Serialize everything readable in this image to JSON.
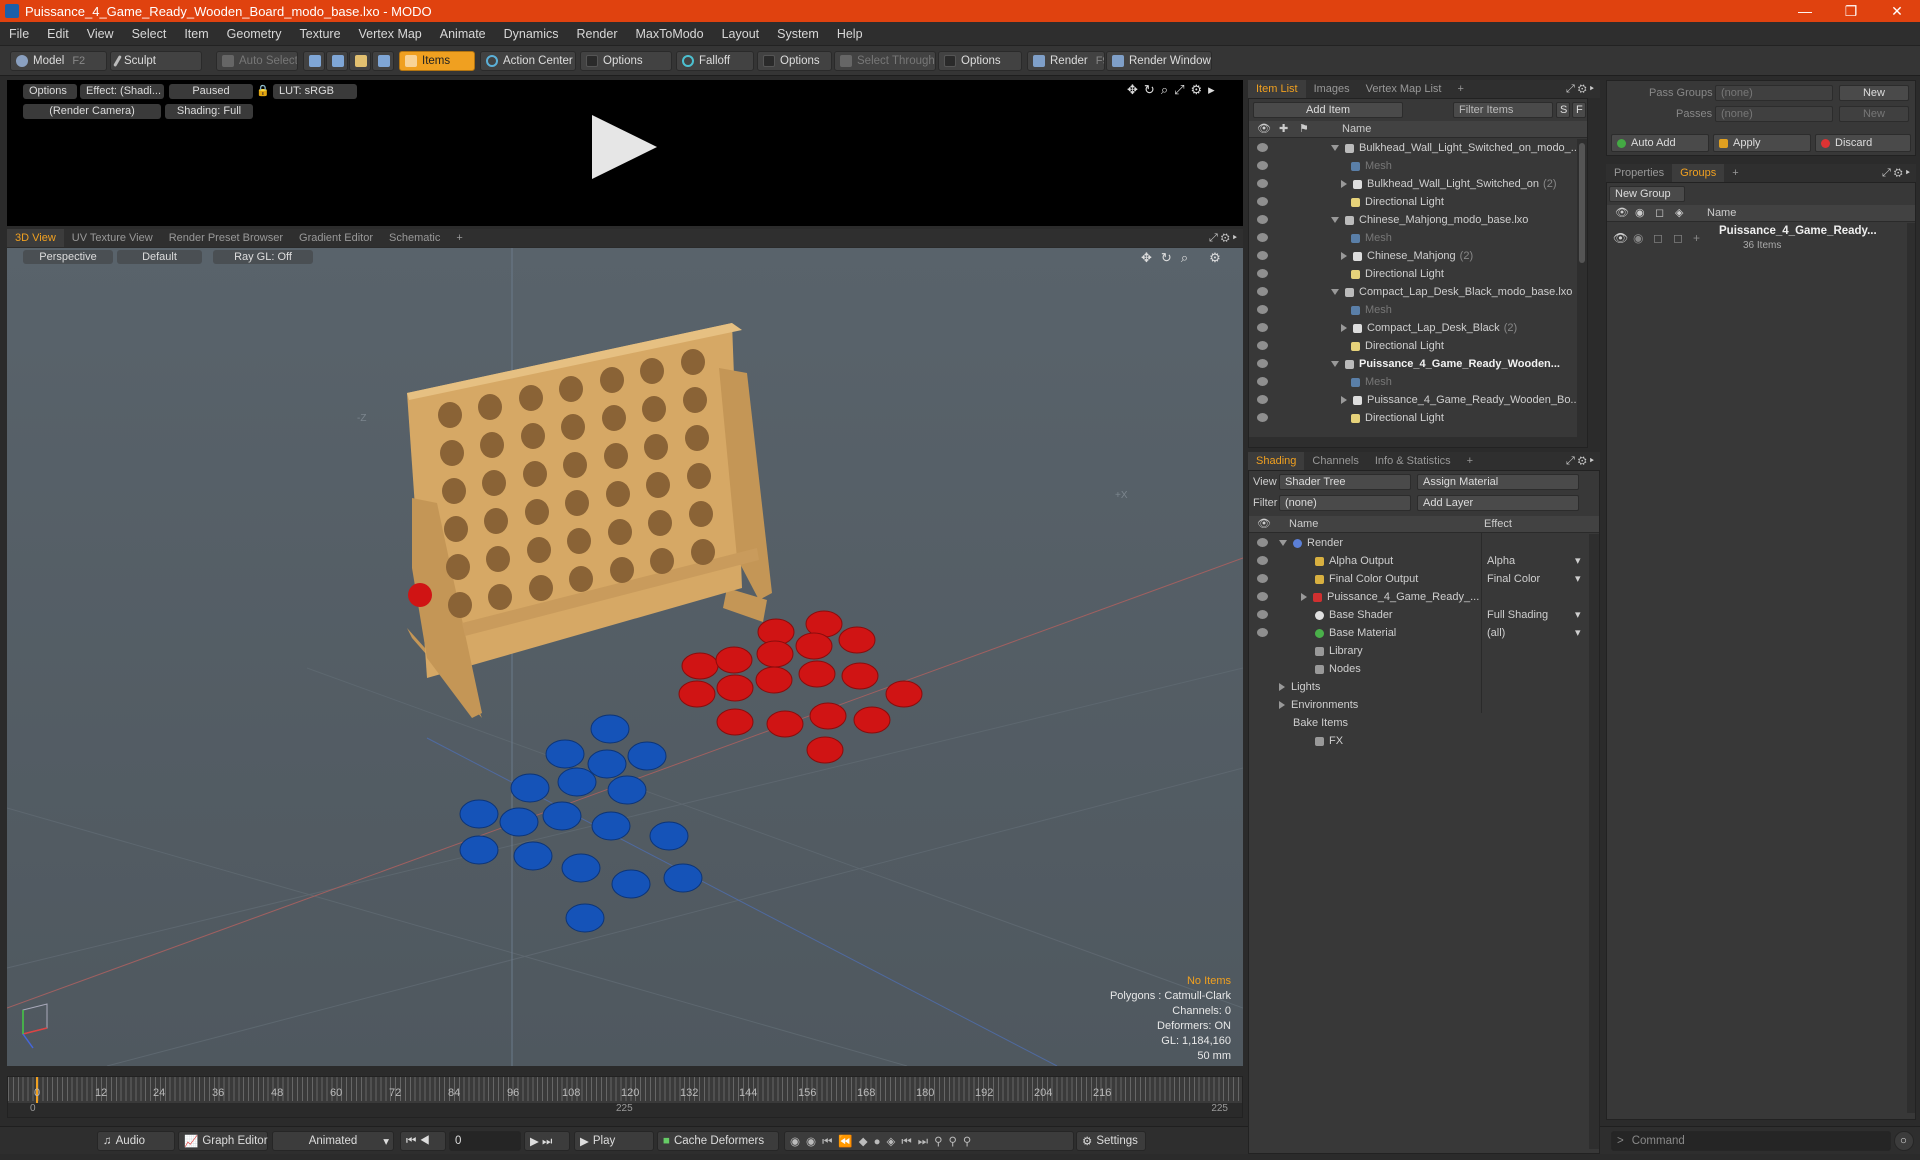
{
  "title": "Puissance_4_Game_Ready_Wooden_Board_modo_base.lxo - MODO",
  "window_controls": [
    "—",
    "❐",
    "✕"
  ],
  "menu": [
    "File",
    "Edit",
    "View",
    "Select",
    "Item",
    "Geometry",
    "Texture",
    "Vertex Map",
    "Animate",
    "Dynamics",
    "Render",
    "MaxToModo",
    "Layout",
    "System",
    "Help"
  ],
  "toolbar": {
    "model": "Model",
    "model_key": "F2",
    "sculpt": "Sculpt",
    "auto_select": "Auto Select",
    "items": "Items",
    "action_center": "Action Center",
    "options1": "Options",
    "falloff": "Falloff",
    "options2": "Options",
    "select_through": "Select Through",
    "options3": "Options",
    "render": "Render",
    "render_key": "F9",
    "render_window": "Render Window"
  },
  "preview": {
    "options": "Options",
    "effect": "Effect: (Shadi...",
    "paused": "Paused",
    "lut": "LUT: sRGB",
    "camera": "(Render Camera)",
    "shading": "Shading: Full"
  },
  "view_tabs": [
    "3D View",
    "UV Texture View",
    "Render Preset Browser",
    "Gradient Editor",
    "Schematic",
    "+"
  ],
  "viewport": {
    "perspective": "Perspective",
    "default": "Default",
    "raygl": "Ray GL: Off",
    "axis_z": "-Z",
    "axis_x": "+X",
    "no_items": "No Items",
    "polygons": "Polygons : Catmull-Clark",
    "channels": "Channels: 0",
    "deformers": "Deformers: ON",
    "gl": "GL: 1,184,160",
    "focal": "50 mm"
  },
  "timeline": {
    "ticks": [
      "0",
      "12",
      "24",
      "36",
      "48",
      "60",
      "72",
      "84",
      "96",
      "108",
      "120",
      "132",
      "144",
      "156",
      "168",
      "180",
      "192",
      "204",
      "216"
    ],
    "start": "0",
    "mid": "225",
    "end": "225"
  },
  "bottom": {
    "audio": "Audio",
    "graph_editor": "Graph Editor",
    "animated": "Animated",
    "frame": "0",
    "play": "Play",
    "cache": "Cache Deformers",
    "settings": "Settings",
    "command": "Command"
  },
  "item_list": {
    "tabs": [
      "Item List",
      "Images",
      "Vertex Map List",
      "+"
    ],
    "add_item": "Add Item",
    "filter": "Filter Items",
    "s": "S",
    "f": "F",
    "col_name": "Name",
    "rows": [
      {
        "text": "Bulkhead_Wall_Light_Switched_on_modo_...",
        "indent": 0,
        "kind": "scene",
        "style": ""
      },
      {
        "text": "Mesh",
        "indent": 2,
        "kind": "mesh",
        "style": "dim"
      },
      {
        "text": "Bulkhead_Wall_Light_Switched_on",
        "sub": "(2)",
        "indent": 1,
        "kind": "group",
        "style": ""
      },
      {
        "text": "Directional Light",
        "indent": 2,
        "kind": "light",
        "style": ""
      },
      {
        "text": "Chinese_Mahjong_modo_base.lxo",
        "indent": 0,
        "kind": "scene",
        "style": ""
      },
      {
        "text": "Mesh",
        "indent": 2,
        "kind": "mesh",
        "style": "dim"
      },
      {
        "text": "Chinese_Mahjong",
        "sub": "(2)",
        "indent": 1,
        "kind": "group",
        "style": ""
      },
      {
        "text": "Directional Light",
        "indent": 2,
        "kind": "light",
        "style": ""
      },
      {
        "text": "Compact_Lap_Desk_Black_modo_base.lxo",
        "indent": 0,
        "kind": "scene",
        "style": ""
      },
      {
        "text": "Mesh",
        "indent": 2,
        "kind": "mesh",
        "style": "dim"
      },
      {
        "text": "Compact_Lap_Desk_Black",
        "sub": "(2)",
        "indent": 1,
        "kind": "group",
        "style": ""
      },
      {
        "text": "Directional Light",
        "indent": 2,
        "kind": "light",
        "style": ""
      },
      {
        "text": "Puissance_4_Game_Ready_Wooden...",
        "indent": 0,
        "kind": "scene",
        "style": "bold"
      },
      {
        "text": "Mesh",
        "indent": 2,
        "kind": "mesh",
        "style": "dim"
      },
      {
        "text": "Puissance_4_Game_Ready_Wooden_Bo...",
        "indent": 1,
        "kind": "group",
        "style": ""
      },
      {
        "text": "Directional Light",
        "indent": 2,
        "kind": "light",
        "style": ""
      }
    ]
  },
  "shading": {
    "tabs": [
      "Shading",
      "Channels",
      "Info & Statistics",
      "+"
    ],
    "view_label": "View",
    "view_value": "Shader Tree",
    "assign": "Assign Material",
    "filter_label": "Filter",
    "filter_value": "(none)",
    "add_layer": "Add Layer",
    "col_name": "Name",
    "col_effect": "Effect",
    "rows": [
      {
        "name": "Render",
        "effect": "",
        "indent": 0
      },
      {
        "name": "Alpha Output",
        "effect": "Alpha",
        "indent": 1
      },
      {
        "name": "Final Color Output",
        "effect": "Final Color",
        "indent": 1
      },
      {
        "name": "Puissance_4_Game_Ready_...",
        "effect": "",
        "indent": 1
      },
      {
        "name": "Base Shader",
        "effect": "Full Shading",
        "indent": 1
      },
      {
        "name": "Base Material",
        "effect": "(all)",
        "indent": 1
      },
      {
        "name": "Library",
        "effect": "",
        "indent": 1
      },
      {
        "name": "Nodes",
        "effect": "",
        "indent": 1
      },
      {
        "name": "Lights",
        "effect": "",
        "indent": 0
      },
      {
        "name": "Environments",
        "effect": "",
        "indent": 0
      },
      {
        "name": "Bake Items",
        "effect": "",
        "indent": 0
      },
      {
        "name": "FX",
        "effect": "",
        "indent": 1
      }
    ]
  },
  "right": {
    "pass_groups_label": "Pass Groups",
    "pass_groups_value": "(none)",
    "new": "New",
    "passes_label": "Passes",
    "passes_value": "(none)",
    "new2": "New",
    "auto_add": "Auto Add",
    "apply": "Apply",
    "discard": "Discard",
    "tabs": [
      "Properties",
      "Groups",
      "+"
    ],
    "new_group": "New Group",
    "col_name": "Name",
    "group_name": "Puissance_4_Game_Ready...",
    "group_count": "36 Items"
  },
  "colors": {
    "accent": "#f0a020",
    "title": "#e0420f",
    "red_token": "#d01414",
    "blue_token": "#1553b8",
    "wood": "#d6a865"
  }
}
